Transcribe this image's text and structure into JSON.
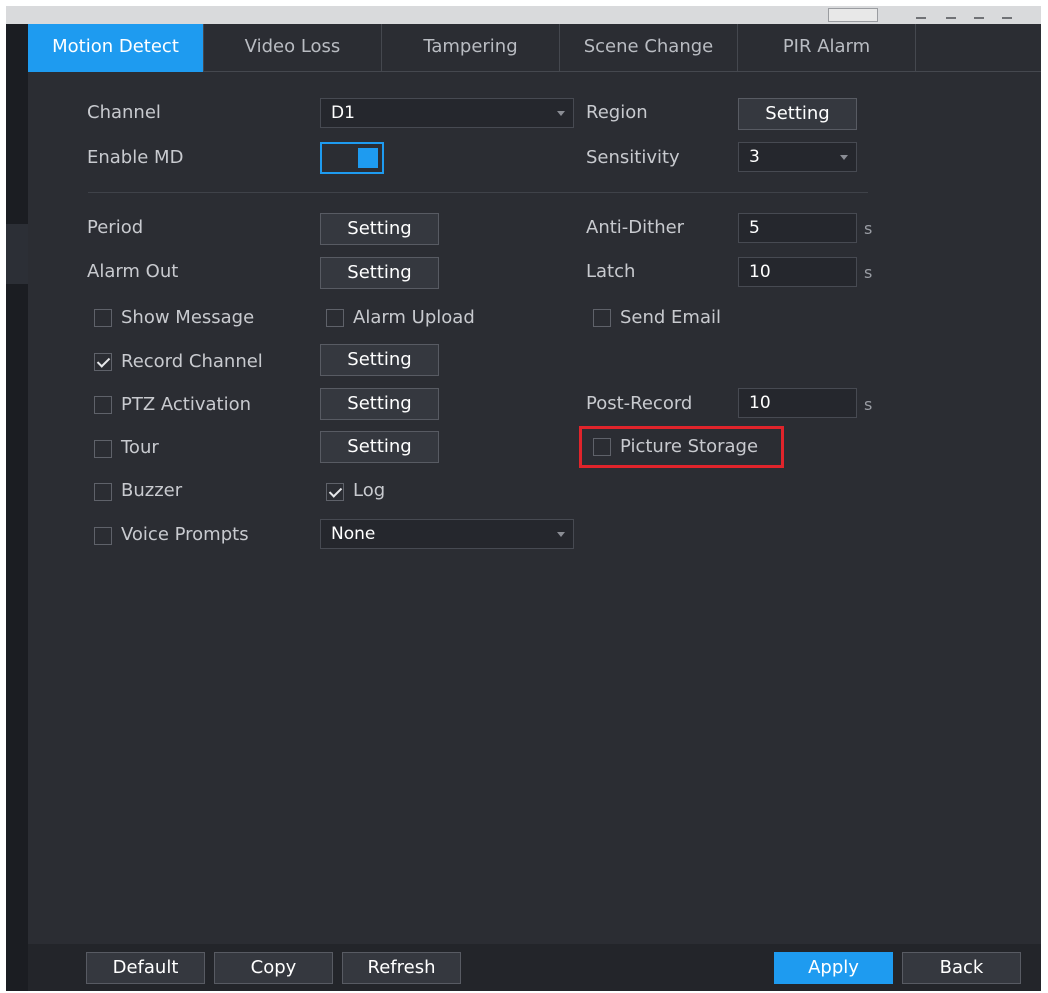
{
  "tabs": [
    {
      "label": "Motion Detect",
      "active": true
    },
    {
      "label": "Video Loss",
      "active": false
    },
    {
      "label": "Tampering",
      "active": false
    },
    {
      "label": "Scene Change",
      "active": false
    },
    {
      "label": "PIR Alarm",
      "active": false
    }
  ],
  "channel": {
    "label": "Channel",
    "value": "D1"
  },
  "region": {
    "label": "Region",
    "button": "Setting"
  },
  "enable_md": {
    "label": "Enable MD",
    "on": true
  },
  "sensitivity": {
    "label": "Sensitivity",
    "value": "3"
  },
  "period": {
    "label": "Period",
    "button": "Setting"
  },
  "anti_dither": {
    "label": "Anti-Dither",
    "value": "5",
    "unit": "s"
  },
  "alarm_out": {
    "label": "Alarm Out",
    "button": "Setting"
  },
  "latch": {
    "label": "Latch",
    "value": "10",
    "unit": "s"
  },
  "show_message": {
    "label": "Show Message",
    "checked": false
  },
  "alarm_upload": {
    "label": "Alarm Upload",
    "checked": false
  },
  "send_email": {
    "label": "Send Email",
    "checked": false
  },
  "record_channel": {
    "label": "Record Channel",
    "checked": true,
    "button": "Setting"
  },
  "ptz_activation": {
    "label": "PTZ Activation",
    "checked": false,
    "button": "Setting"
  },
  "post_record": {
    "label": "Post-Record",
    "value": "10",
    "unit": "s"
  },
  "tour": {
    "label": "Tour",
    "checked": false,
    "button": "Setting"
  },
  "picture_storage": {
    "label": "Picture Storage",
    "checked": false
  },
  "buzzer": {
    "label": "Buzzer",
    "checked": false
  },
  "log": {
    "label": "Log",
    "checked": true
  },
  "voice_prompts": {
    "label": "Voice Prompts",
    "checked": false,
    "value": "None"
  },
  "footer": {
    "default": "Default",
    "copy": "Copy",
    "refresh": "Refresh",
    "apply": "Apply",
    "back": "Back"
  },
  "colors": {
    "accent": "#1e9bf0",
    "highlight": "#e0242b",
    "background": "#2b2d33"
  }
}
